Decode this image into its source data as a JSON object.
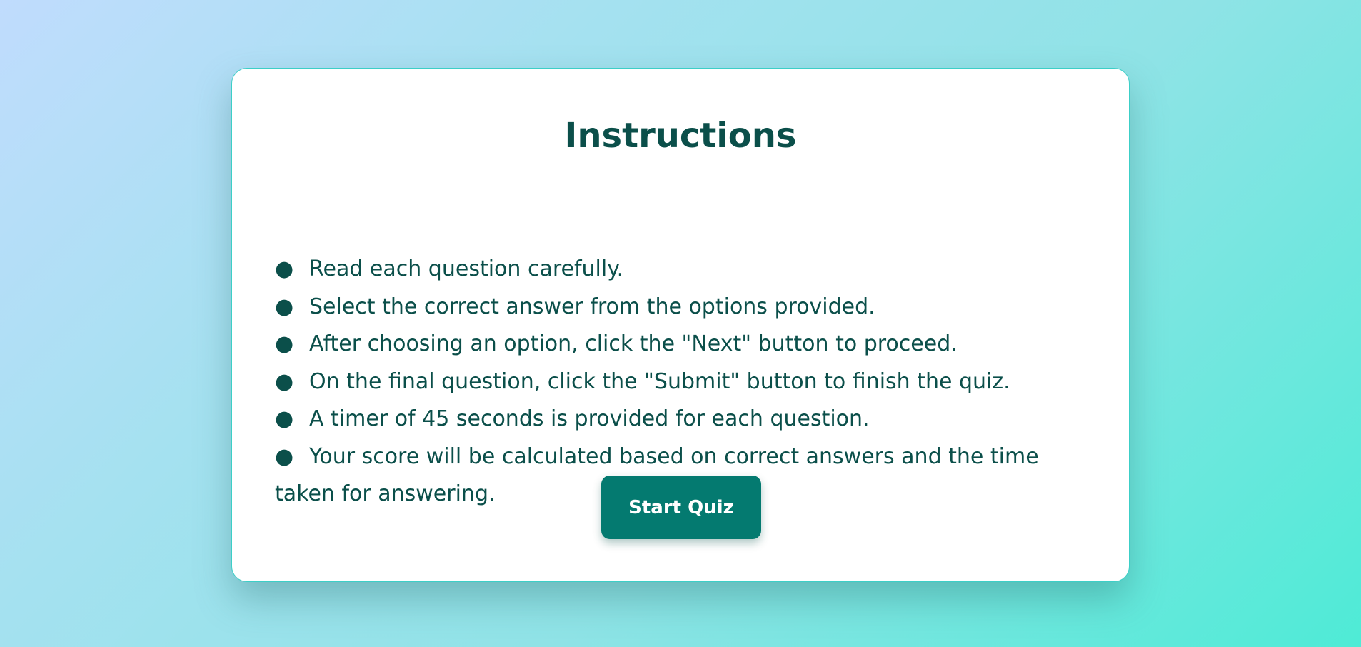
{
  "instructions": {
    "title": "Instructions",
    "items": [
      "Read each question carefully.",
      "Select the correct answer from the options provided.",
      "After choosing an option, click the \"Next\" button to proceed.",
      "On the final question, click the \"Submit\" button to finish the quiz.",
      "A timer of 45 seconds is provided for each question.",
      "Your score will be calculated based on correct answers and the time taken for answering."
    ],
    "start_button_label": "Start Quiz"
  },
  "colors": {
    "text": "#0b4f4a",
    "button": "#047a70",
    "card_border": "#3ccfc7"
  }
}
